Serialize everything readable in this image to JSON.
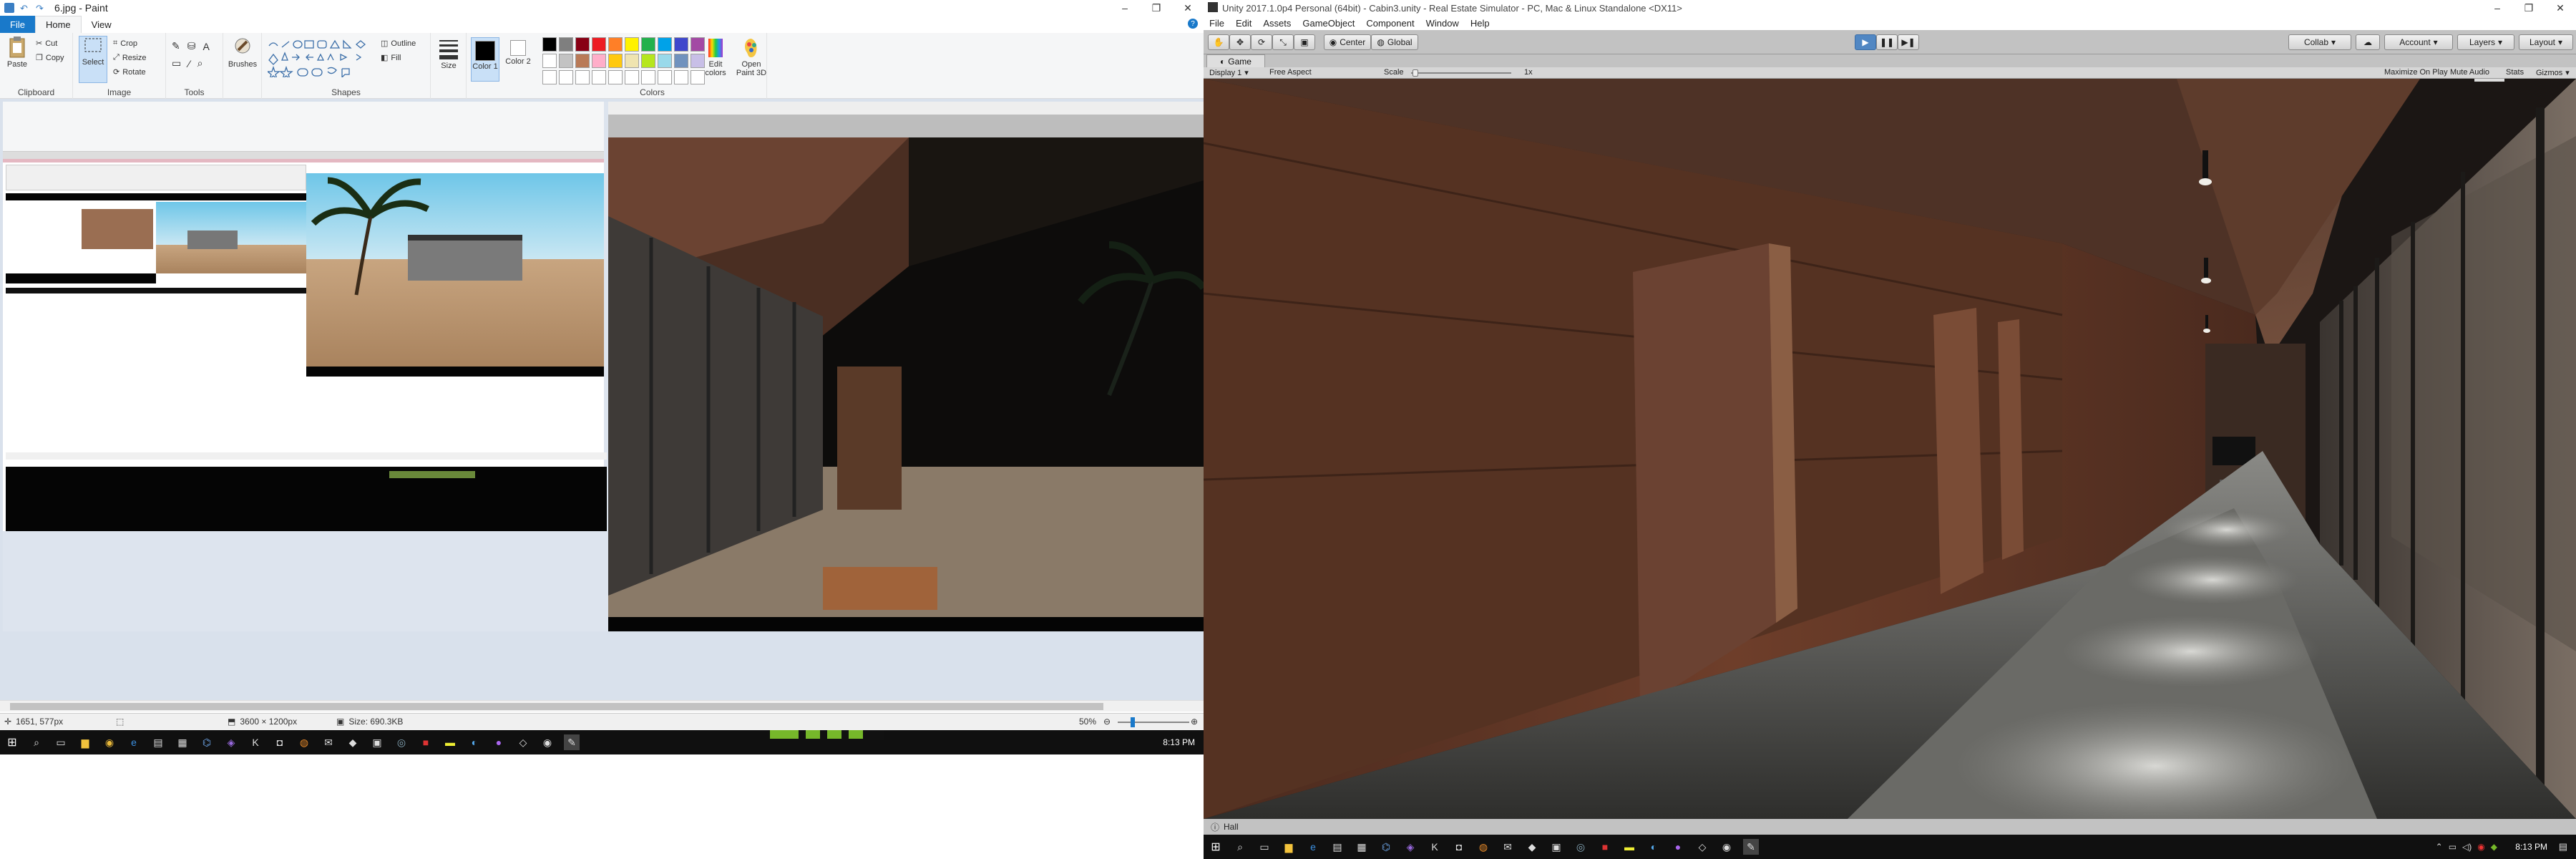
{
  "paint": {
    "title": "6.jpg - Paint",
    "window_controls": [
      "–",
      "❐",
      "✕"
    ],
    "tabs": [
      "File",
      "Home",
      "View"
    ],
    "ribbon": {
      "clipboard": {
        "label": "Clipboard",
        "paste": "Paste",
        "cut": "Cut",
        "copy": "Copy"
      },
      "image": {
        "label": "Image",
        "select": "Select",
        "crop": "Crop",
        "resize": "Resize",
        "rotate": "Rotate"
      },
      "tools": {
        "label": "Tools"
      },
      "brushes": "Brushes",
      "shapes": {
        "label": "Shapes",
        "outline": "Outline",
        "fill": "Fill"
      },
      "size": "Size",
      "color1": "Color 1",
      "color2": "Color 2",
      "colors": {
        "label": "Colors",
        "edit": "Edit colors",
        "open3d": "Open Paint 3D"
      },
      "palette": [
        "#000000",
        "#7f7f7f",
        "#880015",
        "#ed1c24",
        "#ff7f27",
        "#fff200",
        "#22b14c",
        "#00a2e8",
        "#3f48cc",
        "#a349a4",
        "#ffffff",
        "#c3c3c3",
        "#b97a57",
        "#ffaec9",
        "#ffc90e",
        "#efe4b0",
        "#b5e61d",
        "#99d9ea",
        "#7092be",
        "#c8bfe7",
        "#ffffff",
        "#ffffff",
        "#ffffff",
        "#ffffff",
        "#ffffff",
        "#ffffff",
        "#ffffff",
        "#ffffff",
        "#ffffff",
        "#ffffff"
      ]
    },
    "status": {
      "cursor": "1651, 577px",
      "dimensions": "3600 × 1200px",
      "size": "Size: 690.3KB",
      "zoom": "50%"
    }
  },
  "taskbar_left": {
    "time": "8:13 PM"
  },
  "unity": {
    "title": "Unity 2017.1.0p4 Personal (64bit) - Cabin3.unity - Real Estate Simulator - PC, Mac & Linux Standalone <DX11>",
    "window_controls": [
      "–",
      "❐",
      "✕"
    ],
    "menu": [
      "File",
      "Edit",
      "Assets",
      "GameObject",
      "Component",
      "Window",
      "Help"
    ],
    "toolbar": {
      "pivot": "Center",
      "space": "Global",
      "collab": "Collab",
      "account": "Account",
      "layers": "Layers",
      "layout": "Layout"
    },
    "game_tab": "Game",
    "game_bar": {
      "display": "Display 1",
      "aspect": "Free Aspect",
      "scale_label": "Scale",
      "scale_value": "1x",
      "maximize": "Maximize On Play",
      "mute": "Mute Audio",
      "stats": "Stats",
      "gizmos": "Gizmos"
    },
    "status": "Hall"
  },
  "taskbar_right": {
    "time": "8:13 PM"
  }
}
